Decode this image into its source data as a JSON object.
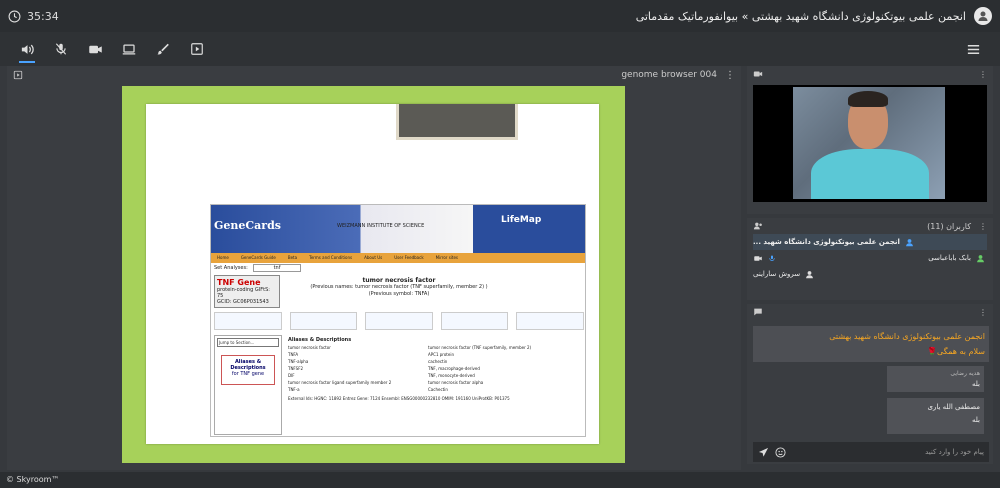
{
  "header": {
    "timer": "35:34",
    "room_title": "انجمن علمی بیوتکنولوژی دانشگاه شهید بهشتی » بیوانفورماتیک مقدماتی"
  },
  "main": {
    "title": "genome browser 004"
  },
  "slide": {
    "logo": "GeneCards",
    "weizmann": "WEIZMANN INSTITUTE OF SCIENCE",
    "lifemap": "LifeMap",
    "nav": [
      "Home",
      "GeneCards Guide",
      "Beta",
      "Terms and Conditions",
      "About Us",
      "User Feedback",
      "Mirror sites"
    ],
    "search_label": "Set Analyses:",
    "search_value": "tnf",
    "gene": "TNF Gene",
    "gene_type": "protein-coding",
    "gifts": "GIFtS: 75",
    "gcid": "GCID: GC06P031543",
    "gene_name": "tumor necrosis factor",
    "prev": "(Previous names: tumor necrosis factor (TNF superfamily, member 2) )",
    "symbol": "(Previous symbol: TNFA)",
    "jump": "Jump to Section...",
    "aliases_title": "Aliases & Descriptions",
    "aliases_for": "for TNF gene",
    "aliases_header": "Aliases & Descriptions",
    "aliases": [
      "tumor necrosis factor",
      "TNFA",
      "TNF-alpha",
      "TNFSF2",
      "DIF",
      "tumor necrosis factor ligand superfamily member 2",
      "TNF-a"
    ],
    "descriptions": [
      "tumor necrosis factor (TNF superfamily, member 2)",
      "APC1 protein",
      "cachectin",
      "TNF, macrophage-derived",
      "TNF, monocyte-derived",
      "tumor necrosis factor alpha",
      "Cachectin"
    ],
    "ext_ids": "External Ids:  HGNC: 11892  Entrez Gene: 7124  Ensembl: ENSG00000232810  OMIM: 191160  UniProtKB: P01375"
  },
  "participants": {
    "title": "کاربران (11)",
    "list": [
      "انجمن علمی بیوتکنولوژی دانشگاه شهید ...",
      "بابک باباعباسی",
      "سروش ساراینی"
    ]
  },
  "chat": {
    "banner": "انجمن علمی بیوتکنولوژی دانشگاه شهید بهشتی",
    "banner2": "سلام به همگی🌹",
    "messages": [
      {
        "name": "هدیه رضایی",
        "text": "بله"
      },
      {
        "name": "مصطفی الله یاری",
        "text": "بله"
      }
    ],
    "placeholder": "پیام خود را وارد کنید"
  },
  "footer": {
    "brand": "© Skyroom™"
  }
}
